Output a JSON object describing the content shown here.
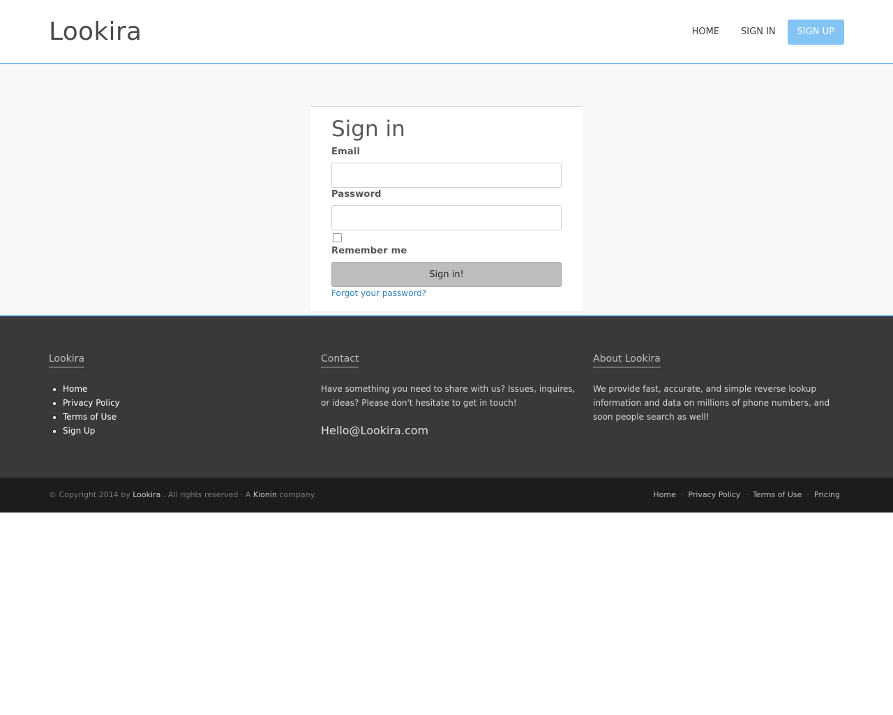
{
  "header": {
    "logo": "Lookira",
    "nav": {
      "home": "HOME",
      "sign_in": "SIGN IN",
      "sign_up": "SIGN UP"
    }
  },
  "signin": {
    "title": "Sign in",
    "email_label": "Email",
    "email_value": "",
    "password_label": "Password",
    "password_value": "",
    "remember_label": "Remember me",
    "remember_checked": false,
    "submit_label": "Sign in!",
    "forgot_label": "Forgot your password?"
  },
  "footer": {
    "col1": {
      "heading": "Lookira",
      "links": [
        "Home",
        "Privacy Policy",
        "Terms of Use",
        "Sign Up"
      ]
    },
    "col2": {
      "heading": "Contact",
      "text": "Have something you need to share with us? Issues, inquires, or ideas? Please don't hesitate to get in touch!",
      "email": "Hello@Lookira.com"
    },
    "col3": {
      "heading": "About Lookira",
      "text": "We provide fast, accurate, and simple reverse lookup information and data on millions of phone numbers, and soon people search as well!"
    }
  },
  "bottom": {
    "copyright_prefix": "© Copyright 2014 by",
    "brand": "Lookira",
    "rights": ". All rights reserved · A",
    "company": "Kionin",
    "company_suffix": "company.",
    "links": [
      "Home",
      "Privacy Policy",
      "Terms of Use",
      "Pricing"
    ],
    "separator": "·"
  },
  "colors": {
    "accent": "#84c4f4",
    "header_border": "#7cc0ef",
    "footer_bg": "#3a383b",
    "bottom_bg": "#1c1c1c",
    "link": "#2e7fb8"
  }
}
